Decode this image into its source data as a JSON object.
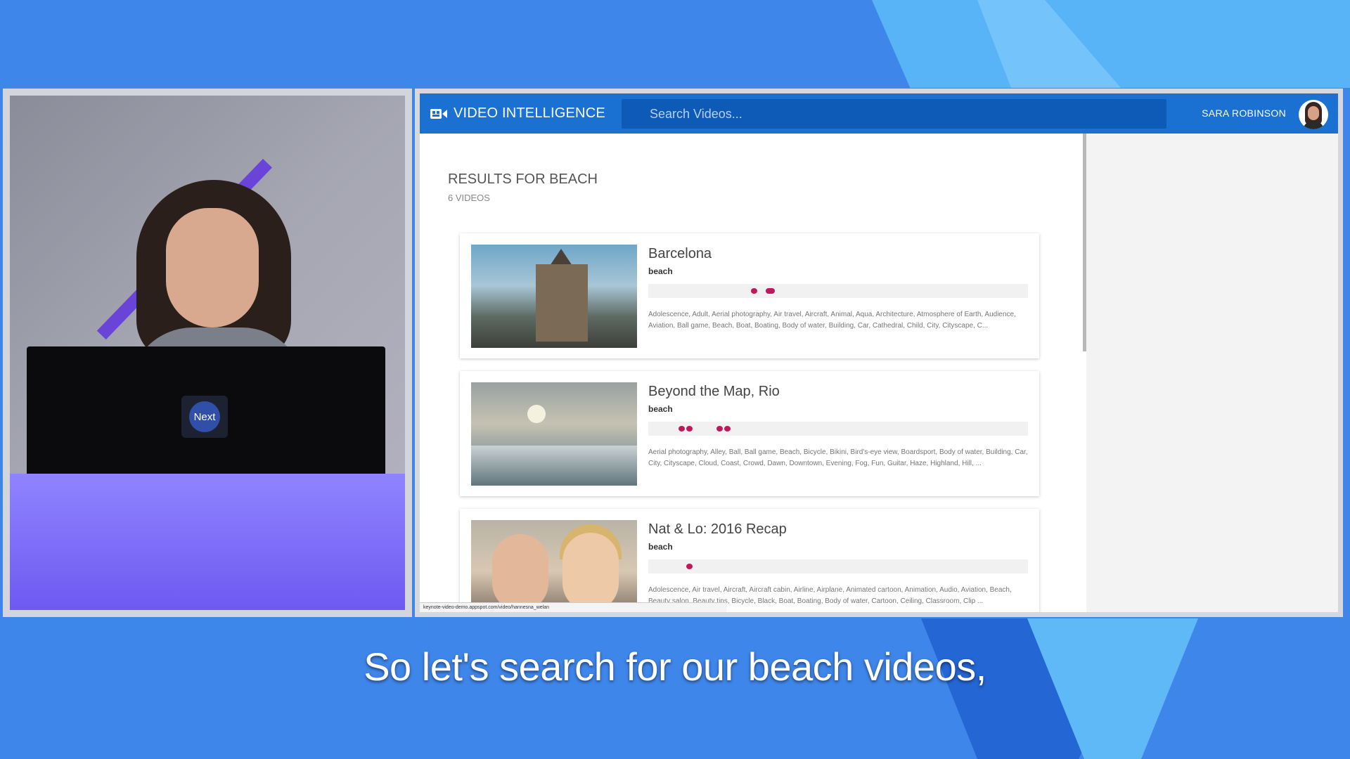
{
  "app": {
    "brand": "VIDEO INTELLIGENCE",
    "search_placeholder": "Search Videos...",
    "user_name": "SARA ROBINSON"
  },
  "results": {
    "title": "RESULTS FOR BEACH",
    "count": "6 VIDEOS",
    "items": [
      {
        "title": "Barcelona",
        "tag": "beach",
        "description": "Adolescence, Adult, Aerial photography, Air travel, Aircraft, Animal, Aqua, Architecture, Atmosphere of Earth, Audience, Aviation, Ball game, Beach, Boat, Boating, Body of water, Building, Car, Cathedral, Child, City, Cityscape, C...",
        "markers": [
          0.27,
          0.31
        ]
      },
      {
        "title": "Beyond the Map, Rio",
        "tag": "beach",
        "description": "Aerial photography, Alley, Ball, Ball game, Beach, Bicycle, Bikini, Bird's-eye view, Boardsport, Body of water, Building, Car, City, Cityscape, Cloud, Coast, Crowd, Dawn, Downtown, Evening, Fog, Fun, Guitar, Haze, Highland, Hill, ...",
        "markers": [
          0.08,
          0.18
        ]
      },
      {
        "title": "Nat & Lo: 2016 Recap",
        "tag": "beach",
        "description": "Adolescence, Air travel, Aircraft, Aircraft cabin, Airline, Airplane, Animated cartoon, Animation, Audio, Aviation, Beach, Beauty salon, Beauty tips, Bicycle, Black, Boat, Boating, Body of water, Cartoon, Ceiling, Classroom, Clip ...",
        "markers": [
          0.1
        ]
      }
    ]
  },
  "status_url": "keynote-video-demo.appspot.com/video/hannesna_welan",
  "laptop_logo": "Next",
  "caption": "So let's search for our beach videos,",
  "colors": {
    "app_bar": "#1a71d1",
    "marker": "#c2185b",
    "background": "#3f86ea"
  }
}
